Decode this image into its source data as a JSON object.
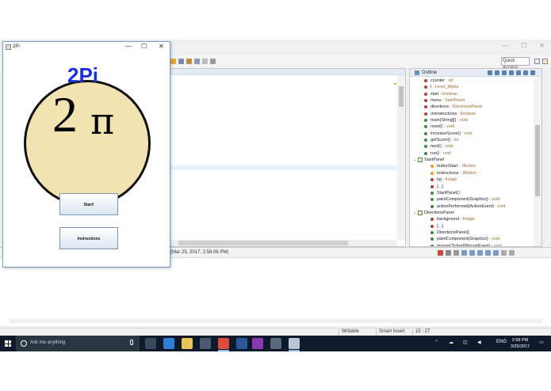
{
  "eclipse": {
    "quick_access": "Quick Access",
    "outline": {
      "title": "Outline",
      "items": [
        {
          "name": "counter",
          "type": " : int",
          "icon": "field-icon",
          "color": "#c0392b",
          "indent": 1
        },
        {
          "name": "l",
          "type": " : Level_Alpha",
          "icon": "field-icon",
          "color": "#c0392b",
          "indent": 1
        },
        {
          "name": "start",
          "type": " : boolean",
          "icon": "field-icon",
          "color": "#c0392b",
          "indent": 1
        },
        {
          "name": "menu",
          "type": " : StartPanel",
          "icon": "field-icon",
          "color": "#c0392b",
          "indent": 1
        },
        {
          "name": "directions",
          "type": " : DirectionsPanel",
          "icon": "field-icon",
          "color": "#c0392b",
          "indent": 1
        },
        {
          "name": "oninstructions",
          "type": " : boolean",
          "icon": "field-icon",
          "color": "#c0392b",
          "indent": 1
        },
        {
          "name": "main(String[])",
          "type": " : void",
          "icon": "method-icon",
          "color": "#3a8a3a",
          "indent": 1
        },
        {
          "name": "reset()",
          "type": " : void",
          "icon": "method-icon",
          "color": "#3a8a3a",
          "indent": 1
        },
        {
          "name": "increaseScore()",
          "type": " : void",
          "icon": "method-icon",
          "color": "#3a8a3a",
          "indent": 1
        },
        {
          "name": "getScore()",
          "type": " : int",
          "icon": "method-icon",
          "color": "#3a8a3a",
          "indent": 1
        },
        {
          "name": "next()",
          "type": " : void",
          "icon": "method-icon",
          "color": "#3a8a3a",
          "indent": 1
        },
        {
          "name": "run()",
          "type": " : void",
          "icon": "method-icon",
          "color": "#3a8a3a",
          "indent": 1
        },
        {
          "name": "StartPanel",
          "type": "",
          "icon": "class-icon",
          "color": "#3a8a3a",
          "indent": 0
        },
        {
          "name": "buttonStart",
          "type": " : JButton",
          "icon": "field-icon",
          "color": "#e0a020",
          "indent": 2
        },
        {
          "name": "instructions",
          "type": " : JButton",
          "icon": "field-icon",
          "color": "#e0a020",
          "indent": 2
        },
        {
          "name": "bg",
          "type": " : Image",
          "icon": "field-icon",
          "color": "#c0392b",
          "indent": 2
        },
        {
          "name": "{...}",
          "type": "",
          "icon": "block-icon",
          "color": "#c0392b",
          "indent": 2
        },
        {
          "name": "StartPanel()",
          "type": "",
          "icon": "constructor-icon",
          "color": "#3a8a3a",
          "indent": 2
        },
        {
          "name": "paintComponent(Graphics)",
          "type": " : void",
          "icon": "method-icon",
          "color": "#3a8a3a",
          "indent": 2
        },
        {
          "name": "actionPerformed(ActionEvent)",
          "type": " : void",
          "icon": "method-icon",
          "color": "#3a8a3a",
          "indent": 2
        },
        {
          "name": "DirectionsPanel",
          "type": "",
          "icon": "class-icon",
          "color": "#3a8a3a",
          "indent": 0
        },
        {
          "name": "background",
          "type": " : Image",
          "icon": "field-icon",
          "color": "#c0392b",
          "indent": 2
        },
        {
          "name": "{...}",
          "type": "",
          "icon": "block-icon",
          "color": "#c0392b",
          "indent": 2
        },
        {
          "name": "DirectionsPanel()",
          "type": "",
          "icon": "constructor-icon",
          "color": "#3a8a3a",
          "indent": 2
        },
        {
          "name": "paintComponent(Graphics)",
          "type": " : void",
          "icon": "method-icon",
          "color": "#3a8a3a",
          "indent": 2
        },
        {
          "name": "mouseClicked(MouseEvent)",
          "type": " : void",
          "icon": "method-icon",
          "color": "#3a8a3a",
          "indent": 2
        }
      ]
    },
    "console": {
      "terminated": "(Mar 25, 2017, 2:58:06 PM)"
    },
    "status": {
      "writable": "Writable",
      "insert_mode": "Smart Insert",
      "position": "15 : 27"
    }
  },
  "app": {
    "window_title": "2Pi",
    "minimize": "—",
    "maximize": "☐",
    "close": "✕",
    "logo": "2Pi",
    "big_digit": "2",
    "big_symbol": "π",
    "start_button": "Start!",
    "instructions_button": "Instructions"
  },
  "taskbar": {
    "search_placeholder": "Ask me anything",
    "language": "ENG",
    "time": "2:58 PM",
    "date": "3/25/2017",
    "apps": [
      {
        "name": "task-view-icon",
        "color": "#3a4a5e"
      },
      {
        "name": "edge-icon",
        "color": "#2f7fd6"
      },
      {
        "name": "file-explorer-icon",
        "color": "#e8c254"
      },
      {
        "name": "store-icon",
        "color": "#4a5a6e"
      },
      {
        "name": "chrome-icon",
        "color": "#e04b3a"
      },
      {
        "name": "word-icon",
        "color": "#2b579a"
      },
      {
        "name": "media-icon",
        "color": "#8a3ab0"
      },
      {
        "name": "calculator-icon",
        "color": "#5a6a7e"
      },
      {
        "name": "java-app-icon",
        "color": "#b8c6d6"
      }
    ]
  }
}
